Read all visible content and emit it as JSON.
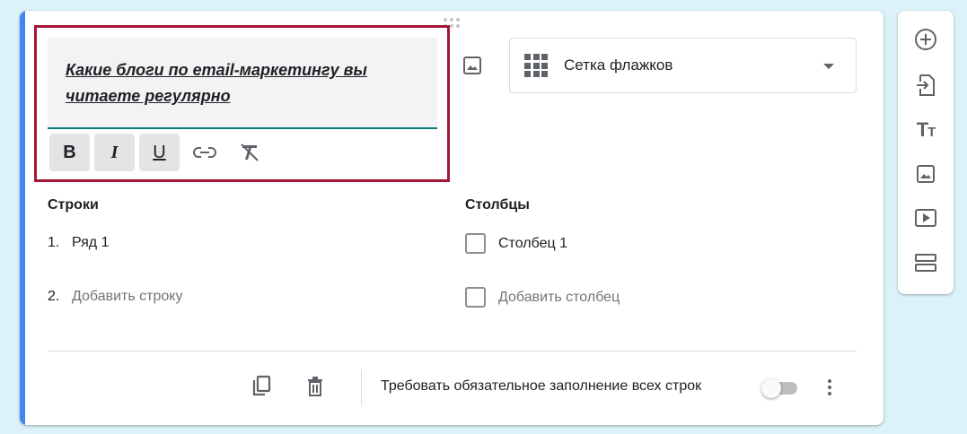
{
  "question": {
    "title": "Какие блоги по email-маркетингу вы читаете регулярно"
  },
  "formatting": {
    "bold": "B",
    "italic": "I",
    "underline": "U"
  },
  "question_type": {
    "selected": "Сетка флажков"
  },
  "rows": {
    "heading": "Строки",
    "items": [
      {
        "num": "1.",
        "label": "Ряд 1"
      }
    ],
    "add": {
      "num": "2.",
      "label": "Добавить строку"
    }
  },
  "columns": {
    "heading": "Столбцы",
    "items": [
      {
        "label": "Столбец 1"
      }
    ],
    "add": {
      "label": "Добавить столбец"
    }
  },
  "footer": {
    "require_label": "Требовать обязательное заполнение всех строк"
  },
  "side_toolbar": {
    "title_text": "Tт"
  },
  "colors": {
    "accent": "#4285f4",
    "highlight_frame": "#a51634",
    "underline_active": "#0b7b7e",
    "background": "#dbf2f8"
  }
}
